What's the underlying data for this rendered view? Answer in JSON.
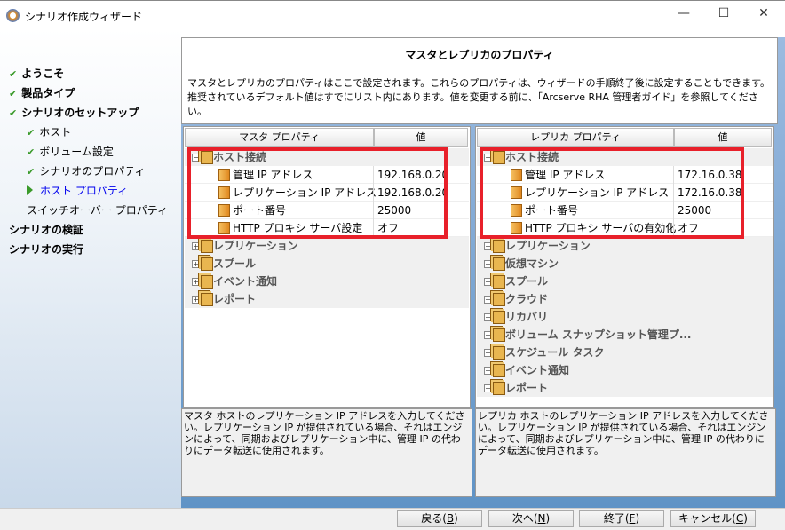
{
  "window": {
    "title": "シナリオ作成ウィザード",
    "minimize": "—",
    "maximize": "☐",
    "close": "✕"
  },
  "sidebar": {
    "steps": [
      {
        "label": "ようこそ",
        "state": "done"
      },
      {
        "label": "製品タイプ",
        "state": "done"
      },
      {
        "label": "シナリオのセットアップ",
        "state": "done"
      },
      {
        "label": "ホスト",
        "state": "done"
      },
      {
        "label": "ボリューム設定",
        "state": "done"
      },
      {
        "label": "シナリオのプロパティ",
        "state": "done"
      },
      {
        "label": "ホスト プロパティ",
        "state": "current"
      },
      {
        "label": "スイッチオーバー プロパティ",
        "state": "pending"
      },
      {
        "label": "シナリオの検証",
        "state": "pending"
      },
      {
        "label": "シナリオの実行",
        "state": "pending"
      }
    ],
    "check": "✔"
  },
  "header": {
    "title": "マスタとレプリカのプロパティ",
    "line1": "マスタとレプリカのプロパティはここで設定されます。これらのプロパティは、ウィザードの手順終了後に設定することもできます。",
    "line2": "推奨されているデフォルト値はすでにリスト内にあります。値を変更する前に、「Arcserve RHA 管理者ガイド」を参照してください。"
  },
  "master": {
    "col_property": "マスタ プロパティ",
    "col_value": "値",
    "group": "ホスト接続",
    "props": [
      {
        "name": "管理 IP アドレス",
        "value": "192.168.0.20"
      },
      {
        "name": "レプリケーション IP アドレス",
        "value": "192.168.0.20"
      },
      {
        "name": "ポート番号",
        "value": "25000"
      },
      {
        "name": "HTTP プロキシ サーバ設定",
        "value": "オフ"
      }
    ],
    "groups": [
      "レプリケーション",
      "スプール",
      "イベント通知",
      "レポート"
    ],
    "description": "マスタ ホストのレプリケーション IP アドレスを入力してください。レプリケーション IP が提供されている場合、それはエンジンによって、同期およびレプリケーション中に、管理 IP の代わりにデータ転送に使用されます。"
  },
  "replica": {
    "col_property": "レプリカ プロパティ",
    "col_value": "値",
    "group": "ホスト接続",
    "props": [
      {
        "name": "管理 IP アドレス",
        "value": "172.16.0.38"
      },
      {
        "name": "レプリケーション IP アドレス",
        "value": "172.16.0.38"
      },
      {
        "name": "ポート番号",
        "value": "25000"
      },
      {
        "name": "HTTP プロキシ サーバの有効化",
        "value": "オフ"
      }
    ],
    "groups": [
      "レプリケーション",
      "仮想マシン",
      "スプール",
      "クラウド",
      "リカバリ",
      "ボリューム スナップショット管理プ...",
      "スケジュール タスク",
      "イベント通知",
      "レポート"
    ],
    "description": "レプリカ ホストのレプリケーション IP アドレスを入力してください。レプリケーション IP が提供されている場合、それはエンジンによって、同期およびレプリケーション中に、管理 IP の代わりにデータ転送に使用されます。"
  },
  "buttons": {
    "back": "戻る",
    "back_key": "B",
    "next": "次へ",
    "next_key": "N",
    "finish": "終了",
    "finish_key": "F",
    "cancel": "キャンセル",
    "cancel_key": "C"
  },
  "tree": {
    "expanded": "−",
    "collapsed": "+"
  }
}
